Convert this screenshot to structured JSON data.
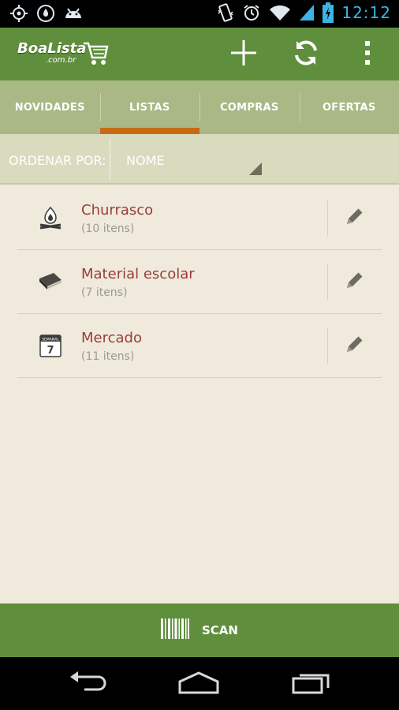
{
  "status_bar": {
    "time": "12:12",
    "left_icons": [
      "gps-icon",
      "data-saver-icon",
      "android-debug-icon"
    ],
    "right_icons": [
      "vibrate-icon",
      "alarm-icon",
      "wifi-icon",
      "signal-icon",
      "battery-charging-icon"
    ]
  },
  "action_bar": {
    "logo_main": "BoaLista",
    "logo_sub": ".com.br",
    "actions": [
      "add-icon",
      "refresh-icon",
      "overflow-menu-icon"
    ]
  },
  "tabs": [
    {
      "label": "NOVIDADES",
      "active": false
    },
    {
      "label": "LISTAS",
      "active": true
    },
    {
      "label": "COMPRAS",
      "active": false
    },
    {
      "label": "OFERTAS",
      "active": false
    }
  ],
  "sort": {
    "label": "ORDENAR POR:",
    "value": "NOME"
  },
  "lists": [
    {
      "name": "Churrasco",
      "count": "(10 itens)",
      "icon": "barbecue-icon"
    },
    {
      "name": "Material escolar",
      "count": "(7 itens)",
      "icon": "book-icon"
    },
    {
      "name": "Mercado",
      "count": "(11 itens)",
      "icon": "calendar-icon"
    }
  ],
  "calendar_icon_text": {
    "day": "7",
    "header": "SEMANAL"
  },
  "scan": {
    "label": "SCAN"
  },
  "colors": {
    "action_bar": "#5f8e3c",
    "tabs_bg": "#a9b884",
    "tab_indicator": "#c86a15",
    "list_name": "#9a3d3a",
    "background": "#efeadc",
    "clock": "#3ab5e6"
  }
}
